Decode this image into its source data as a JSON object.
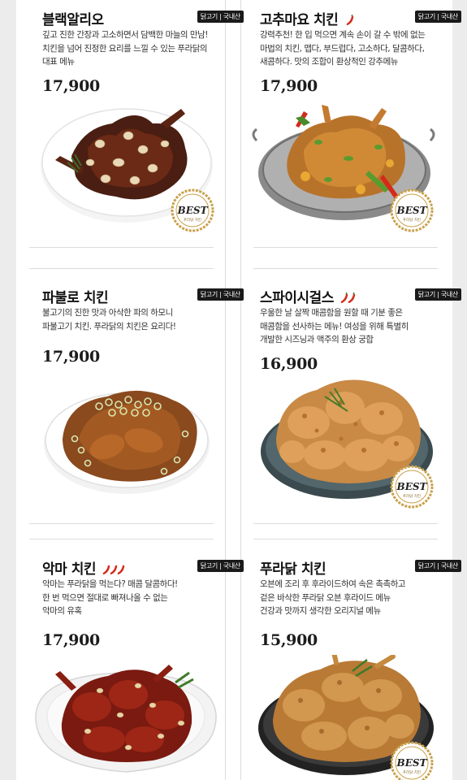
{
  "menu": [
    {
      "name": "블랙알리오",
      "badge": "닭고기 | 국내산",
      "desc": [
        "깊고 진한 간장과 고소하면서 담백한 마늘의 만남!",
        "치킨을 넘어 진정한 요리를 느낄 수 있는 푸라닭의",
        "대표 메뉴"
      ],
      "price": "17,900",
      "spicy": 0,
      "best": true,
      "best_text": "BEST",
      "best_sub": "푸라닭 치킨"
    },
    {
      "name": "고추마요 치킨",
      "badge": "닭고기 | 국내산",
      "desc": [
        "강력추천! 한 입 먹으면 계속 손이 갈 수 밖에 없는",
        "마법의 치킨, 맵다, 부드럽다, 고소하다, 달콤하다,",
        "새콤하다. 맛의 조합이 환상적인 강추메뉴"
      ],
      "price": "17,900",
      "spicy": 1,
      "best": true,
      "best_text": "BEST",
      "best_sub": "푸라닭 치킨"
    },
    {
      "name": "파불로 치킨",
      "badge": "닭고기 | 국내산",
      "desc": [
        "불고기의 진한 맛과 아삭한 파의 하모니",
        "파불고기 치킨. 푸라닭의 치킨은 요리다!"
      ],
      "price": "17,900",
      "spicy": 0,
      "best": false
    },
    {
      "name": "스파이시걸스",
      "badge": "닭고기 | 국내산",
      "desc": [
        "우울한 날 살짝 매콤함을 원할 때 기분 좋은",
        "매콤함을 선사하는 메뉴! 여성을 위해 특별히",
        "개발한 시즈닝과 맥주의 환상 궁합"
      ],
      "price": "16,900",
      "spicy": 2,
      "best": true,
      "best_text": "BEST",
      "best_sub": "푸라닭 치킨"
    },
    {
      "name": "악마 치킨",
      "badge": "닭고기 | 국내산",
      "desc": [
        "악마는 푸라닭을 먹는다? 매콤 달콤하다!",
        "한 번 먹으면 절대로 빠져나올 수 없는",
        "악마의 유혹"
      ],
      "price": "17,900",
      "spicy": 3,
      "best": false
    },
    {
      "name": "푸라닭 치킨",
      "badge": "닭고기 | 국내산",
      "desc": [
        "오븐에 조리 후 후라이드하여 속은 촉촉하고",
        "겉은 바삭한 푸라닭 오븐 후라이드 메뉴",
        "건강과 맛까지 생각한 오리지널 메뉴"
      ],
      "price": "15,900",
      "spicy": 0,
      "best": true,
      "best_text": "BEST",
      "best_sub": "푸라닭 치킨"
    }
  ],
  "colors": {
    "badge_bg": "#1a1a1a",
    "chili_red": "#d42a1a",
    "best_gold": "#c9a04a",
    "frame_gray": "#ececec"
  }
}
